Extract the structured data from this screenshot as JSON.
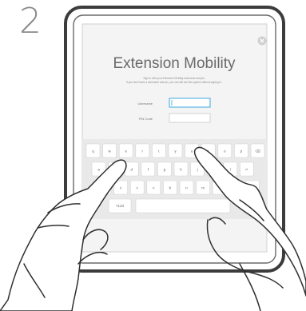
{
  "step": {
    "number": "2"
  },
  "screen": {
    "title": "Extension Mobility",
    "subtitle_line1": "Sign in with your Extension Mobility username and pin.",
    "subtitle_line2": "If you don't have a username and pin, you can still use this system without signing in.",
    "username_label": "Username",
    "pin_label": "PIN Code",
    "close_icon": "close-icon"
  },
  "keyboard": {
    "row1": [
      "q",
      "w",
      "e",
      "r",
      "t",
      "y",
      "u",
      "i",
      "o",
      "p",
      "⌫"
    ],
    "row2": [
      "a",
      "s",
      "d",
      "f",
      "g",
      "h",
      "j",
      "k",
      "l",
      "↵"
    ],
    "row3": [
      "z",
      "x",
      "c",
      "v",
      "b",
      "n",
      "m",
      ",",
      ".",
      "-"
    ],
    "row4": [
      "?123",
      "space"
    ]
  },
  "colors": {
    "device": "#4a4a4a",
    "screen_bg": "#f4f4f4",
    "input_focus": "#3aa8e0",
    "key_fill": "#ffffff",
    "keyboard_bg": "#e9e9e9"
  }
}
